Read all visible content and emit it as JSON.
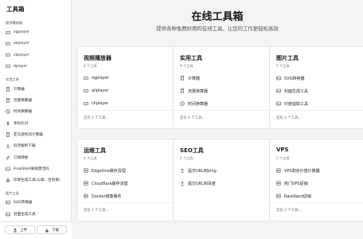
{
  "sidebar": {
    "brand": "工具箱",
    "groups": [
      {
        "title": "视频播放器",
        "items": [
          {
            "label": "xgplayer",
            "icon": "video-icon"
          },
          {
            "label": "aliplayer",
            "icon": "video-icon"
          },
          {
            "label": "ckplayer",
            "icon": "video-icon"
          },
          {
            "label": "dplayer",
            "icon": "video-icon"
          }
        ]
      },
      {
        "title": "实用工具",
        "items": [
          {
            "label": "计算器",
            "icon": "calculator-icon"
          },
          {
            "label": "流量换算器",
            "icon": "calculator-icon"
          },
          {
            "label": "时间换算器",
            "icon": "clock-icon"
          },
          {
            "label": "余份比对",
            "icon": "dollar-icon"
          },
          {
            "label": "亚马逊利润计算器",
            "icon": "calculator-icon"
          },
          {
            "label": "抖音解析下载",
            "icon": "download-icon"
          },
          {
            "label": "订阅转换",
            "icon": "link-icon"
          },
          {
            "label": "FinalShell离线激活码",
            "icon": "terminal-icon"
          },
          {
            "label": "印章生成工具(公章、合同章)",
            "icon": "stamp-icon"
          }
        ]
      },
      {
        "title": "图片工具",
        "items": [
          {
            "label": "SVG转换器",
            "icon": "image-icon"
          },
          {
            "label": "封面生成工具",
            "icon": "image-icon"
          }
        ]
      }
    ],
    "footer": {
      "upload": "上传",
      "download": "下载"
    }
  },
  "main": {
    "title": "在线工具箱",
    "subtitle": "提供各种免费好用的在线工具，让您的工作更轻松高效",
    "cards": [
      {
        "title": "视频播放器",
        "count": "4 个工具",
        "more": "还有 1 个工具...",
        "tools": [
          {
            "label": "xgplayer",
            "icon": "video-icon"
          },
          {
            "label": "aliplayer",
            "icon": "video-icon"
          },
          {
            "label": "ckplayer",
            "icon": "video-icon"
          }
        ]
      },
      {
        "title": "实用工具",
        "count": "9 个工具",
        "more": "还有 6 个工具...",
        "tools": [
          {
            "label": "计算器",
            "icon": "calculator-icon"
          },
          {
            "label": "流量换算器",
            "icon": "calculator-icon"
          },
          {
            "label": "时间换算器",
            "icon": "clock-icon"
          }
        ]
      },
      {
        "title": "图片工具",
        "count": "5 个工具",
        "more": "还有 2 个工具...",
        "tools": [
          {
            "label": "SVG转换器",
            "icon": "image-icon"
          },
          {
            "label": "封面生成工具",
            "icon": "image-icon"
          },
          {
            "label": "印度提取工具",
            "icon": "image-icon"
          }
        ]
      },
      {
        "title": "运维工具",
        "count": "4 个工具",
        "more": "还有 1 个工具...",
        "tools": [
          {
            "label": "EdgeOne缓存清理",
            "icon": "server-icon"
          },
          {
            "label": "Cloudflare缓存清理",
            "icon": "server-icon"
          },
          {
            "label": "Docker镜像服务",
            "icon": "server-icon"
          }
        ]
      },
      {
        "title": "SEO工具",
        "count": "2 个工具",
        "more": "",
        "tools": [
          {
            "label": "提交URL到bing",
            "icon": "upload-icon"
          },
          {
            "label": "提交URL到百度",
            "icon": "upload-icon"
          }
        ]
      },
      {
        "title": "VPS",
        "count": "5 个工具",
        "more": "还有 2 个工具...",
        "tools": [
          {
            "label": "VPS剩余价值计算器",
            "icon": "server-icon"
          },
          {
            "label": "热门VPS促销",
            "icon": "server-icon"
          },
          {
            "label": "RackNerd促销",
            "icon": "server-icon"
          }
        ]
      }
    ]
  }
}
